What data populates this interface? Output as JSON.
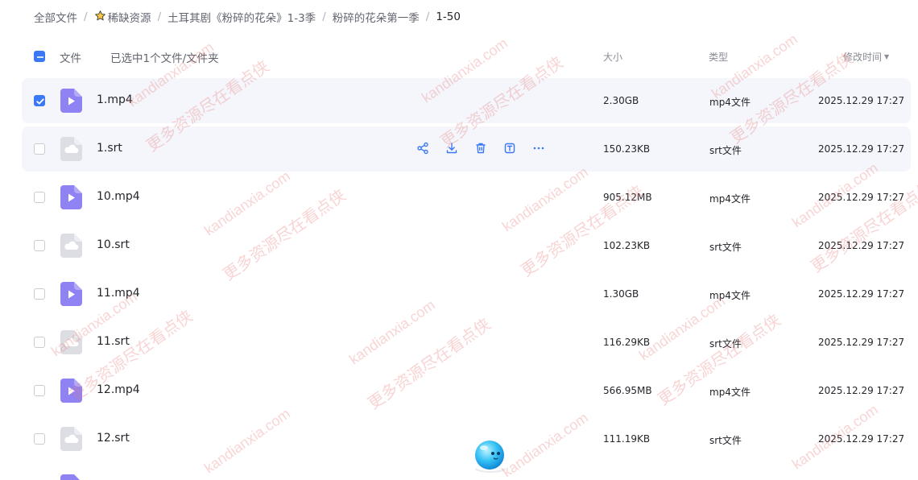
{
  "breadcrumb": [
    {
      "label": "全部文件"
    },
    {
      "label": "稀缺资源",
      "icon": "star-icon"
    },
    {
      "label": "土耳其剧《粉碎的花朵》1-3季"
    },
    {
      "label": "粉碎的花朵第一季"
    },
    {
      "label": "1-50"
    }
  ],
  "header": {
    "name_col": "文件",
    "selection_text": "已选中1个文件/文件夹",
    "size_col": "大小",
    "type_col": "类型",
    "time_col": "修改时间"
  },
  "files": [
    {
      "name": "1.mp4",
      "size": "2.30GB",
      "type": "mp4文件",
      "time": "2025.12.29 17:27",
      "kind": "video"
    },
    {
      "name": "1.srt",
      "size": "150.23KB",
      "type": "srt文件",
      "time": "2025.12.29 17:27",
      "kind": "subtitle"
    },
    {
      "name": "10.mp4",
      "size": "905.12MB",
      "type": "mp4文件",
      "time": "2025.12.29 17:27",
      "kind": "video"
    },
    {
      "name": "10.srt",
      "size": "102.23KB",
      "type": "srt文件",
      "time": "2025.12.29 17:27",
      "kind": "subtitle"
    },
    {
      "name": "11.mp4",
      "size": "1.30GB",
      "type": "mp4文件",
      "time": "2025.12.29 17:27",
      "kind": "video"
    },
    {
      "name": "11.srt",
      "size": "116.29KB",
      "type": "srt文件",
      "time": "2025.12.29 17:27",
      "kind": "subtitle"
    },
    {
      "name": "12.mp4",
      "size": "566.95MB",
      "type": "mp4文件",
      "time": "2025.12.29 17:27",
      "kind": "video"
    },
    {
      "name": "12.srt",
      "size": "111.19KB",
      "type": "srt文件",
      "time": "2025.12.29 17:27",
      "kind": "subtitle"
    }
  ],
  "watermark": {
    "line1": "kandianxia.com",
    "line2": "更多资源尽在看点侠"
  },
  "colors": {
    "accent": "#3b78f6",
    "video_icon": "#8f83f3",
    "subtitle_icon": "#dcdee3",
    "row_highlight": "#f4f6fb"
  }
}
